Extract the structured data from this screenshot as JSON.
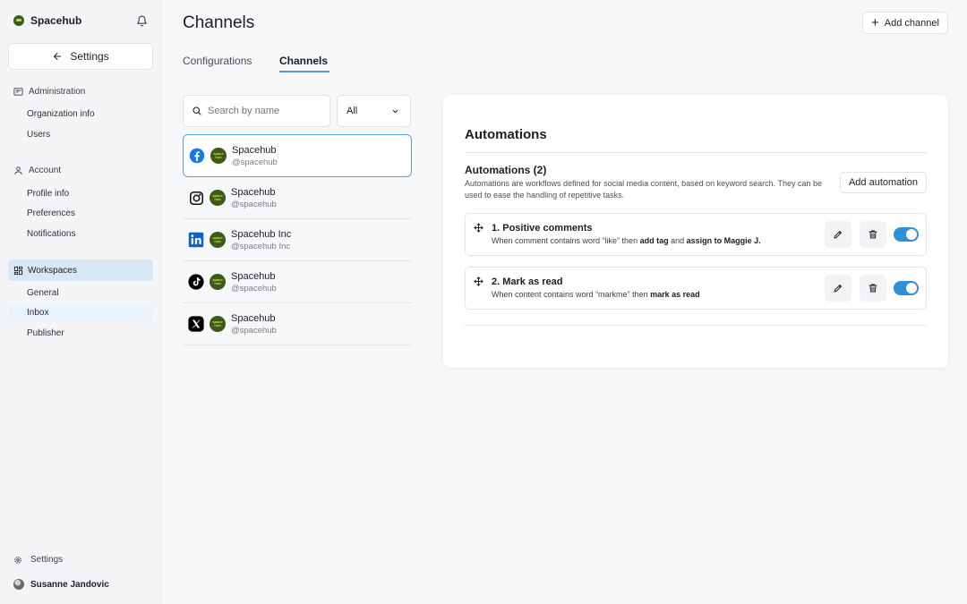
{
  "sidebar": {
    "brand": "Spacehub",
    "settings_button": "Settings",
    "sections": [
      {
        "label": "Administration",
        "items": [
          "Organization info",
          "Users"
        ]
      },
      {
        "label": "Account",
        "items": [
          "Profile info",
          "Preferences",
          "Notifications"
        ]
      },
      {
        "label": "Workspaces",
        "items": [
          "General",
          "Inbox",
          "Publisher"
        ]
      }
    ],
    "bottom_settings": "Settings",
    "user_name": "Susanne Jandovic"
  },
  "header": {
    "title": "Channels",
    "add_channel_label": "Add channel"
  },
  "tabs": [
    "Configurations",
    "Channels"
  ],
  "active_tab": "Channels",
  "search": {
    "placeholder": "Search by name",
    "value": ""
  },
  "filter": {
    "selected": "All"
  },
  "channels": [
    {
      "network": "facebook-icon",
      "name": "Spacehub",
      "handle": "@spacehub",
      "selected": true
    },
    {
      "network": "instagram-icon",
      "name": "Spacehub",
      "handle": "@spacehub",
      "selected": false
    },
    {
      "network": "linkedin-icon",
      "name": "Spacehub Inc",
      "handle": "@spacehub Inc",
      "selected": false
    },
    {
      "network": "tiktok-icon",
      "name": "Spacehub",
      "handle": "@spacehub",
      "selected": false
    },
    {
      "network": "x-icon",
      "name": "Spacehub",
      "handle": "@spacehub",
      "selected": false
    }
  ],
  "automations": {
    "title": "Automations",
    "heading": "Automations (2)",
    "description": "Automations are workflows defined for social media content, based on keyword search. They can be used to ease the handling of repetitive tasks.",
    "add_label": "Add automation",
    "rules": [
      {
        "title": "1. Positive comments",
        "desc_parts": [
          "When comment contains word “like” then ",
          "add tag",
          " and ",
          "assign to Maggie J."
        ],
        "enabled": true
      },
      {
        "title": "2. Mark as read",
        "desc_parts": [
          "When content contains word “markme” then ",
          "mark as read",
          "",
          ""
        ],
        "enabled": true
      }
    ]
  },
  "colors": {
    "accent": "#2e8fd6",
    "active_nav_bg": "#d7e7f6",
    "brand_green": "#3f5a17"
  }
}
